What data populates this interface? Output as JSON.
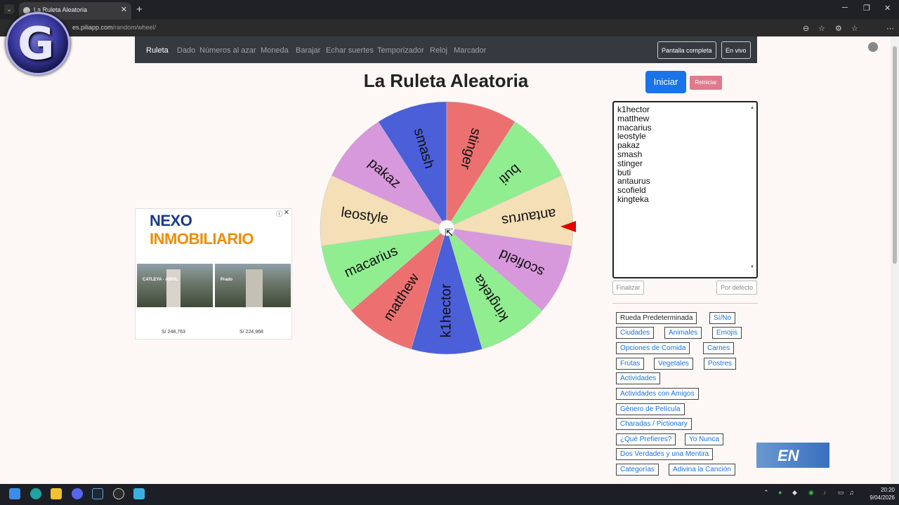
{
  "browser": {
    "tab_title": "La Ruleta Aleatoria",
    "tab_close": "✕",
    "new_tab": "+",
    "url_host": "es.piliapp.com",
    "url_path": "/random/wheel/"
  },
  "watermark_logo": "G",
  "nav": {
    "items": [
      "Ruleta",
      "Dado",
      "Números al azar",
      "Moneda",
      "Barajar",
      "Echar suertes",
      "Temporizador",
      "Reloj",
      "Marcador"
    ],
    "fullscreen_label": "Pantalla completa",
    "live_label": "En vivo"
  },
  "page": {
    "title": "La Ruleta Aleatoria",
    "start_label": "Iniciar",
    "reset_label": "Reiniciar"
  },
  "wheel": {
    "entries": [
      "k1hector",
      "matthew",
      "macarius",
      "leostyle",
      "pakaz",
      "smash",
      "stinger",
      "buti",
      "antaurus",
      "scofield",
      "kingteka"
    ],
    "colors": {
      "k1hector": "#4a5fd8",
      "matthew": "#ec7070",
      "macarius": "#90ee90",
      "leostyle": "#f4dfb6",
      "pakaz": "#d898dc",
      "smash": "#4a5fd8",
      "stinger": "#ec7070",
      "buti": "#90ee90",
      "antaurus": "#f4dfb6",
      "scofield": "#d898dc",
      "kingteka": "#90ee90"
    },
    "pointer_color": "#e00000"
  },
  "entries_text": [
    "k1hector",
    "matthew",
    "macarius",
    "leostyle",
    "pakaz",
    "smash",
    "stinger",
    "buti",
    "antaurus",
    "scofield",
    "kingteka"
  ],
  "editor": {
    "finish_label": "Finalizar",
    "default_label": "Por defecto"
  },
  "presets": [
    {
      "label": "Rueda Predeterminada",
      "active": true
    },
    {
      "label": "Sí/No"
    },
    {
      "label": "Ciudades"
    },
    {
      "label": "Animales"
    },
    {
      "label": "Emojis"
    },
    {
      "label": "Opciones de Comida"
    },
    {
      "label": "Carnes"
    },
    {
      "label": "Frutas"
    },
    {
      "label": "Vegetales"
    },
    {
      "label": "Postres"
    },
    {
      "label": "Actividades"
    },
    {
      "label": "Actividades con Amigos"
    },
    {
      "label": "Género de Película"
    },
    {
      "label": "Charadas / Pictionary"
    },
    {
      "label": "¿Qué Prefieres?"
    },
    {
      "label": "Yo Nunca"
    },
    {
      "label": "Dos Verdades y una Mentira"
    },
    {
      "label": "Categorías"
    },
    {
      "label": "Adivina la Canción"
    }
  ],
  "ad": {
    "brand_a": "NEXO",
    "brand_b": " INMOBILIARIO",
    "img1_label": "CATLEYA · ABRIL",
    "img2_label": "Prado",
    "price1": "S/ 248,763",
    "price2": "S/ 224,968",
    "info": "ⓘ",
    "close": "✕"
  },
  "overlay_text": "EN",
  "clock": {
    "time": "20:20",
    "date": "9/04/2026"
  }
}
